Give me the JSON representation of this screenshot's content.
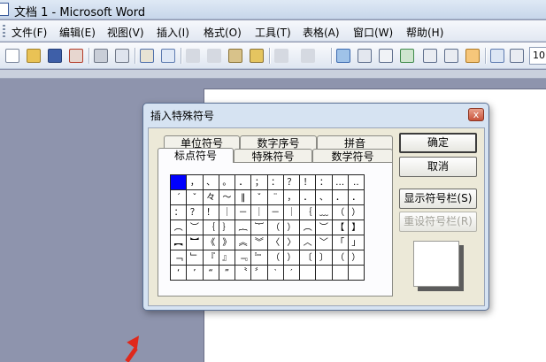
{
  "window": {
    "title": "文档 1 - Microsoft Word"
  },
  "menu": [
    "文件(F)",
    "编辑(E)",
    "视图(V)",
    "插入(I)",
    "格式(O)",
    "工具(T)",
    "表格(A)",
    "窗口(W)",
    "帮助(H)"
  ],
  "toolbar": {
    "zoom_value": "10"
  },
  "dialog": {
    "title": "插入特殊符号",
    "close_label": "x",
    "tabs_back": [
      "单位符号",
      "数字序号",
      "拼音"
    ],
    "tabs_front": [
      "标点符号",
      "特殊符号",
      "数学符号"
    ],
    "active_tab": "标点符号",
    "symbols": [
      [
        "",
        "，",
        "、",
        "。",
        "．",
        "；",
        "：",
        "？",
        "！",
        "：",
        "…",
        "‥"
      ],
      [
        "´",
        "ˇ",
        "々",
        "～",
        "‖",
        "ˇ",
        "¨",
        "，",
        "．",
        "、",
        "．",
        "．"
      ],
      [
        "：",
        "？",
        "！",
        "｜",
        "－",
        "｜",
        "－",
        "｜",
        "｛",
        "﹏",
        "（",
        "）"
      ],
      [
        "︵",
        "︶",
        "｛",
        "｝",
        "︷",
        "︸",
        "（",
        "）",
        "︵",
        "︶",
        "【",
        "】"
      ],
      [
        "︻",
        "︼",
        "《",
        "》",
        "︽",
        "︾",
        "〈",
        "〉",
        "︿",
        "﹀",
        "「",
        "」"
      ],
      [
        "﹁",
        "﹂",
        "『",
        "』",
        "﹃",
        "﹄",
        "（",
        "）",
        "〔",
        "〕",
        "（",
        "）"
      ],
      [
        "‘",
        "’",
        "“",
        "”",
        "〝",
        "〞",
        "‵",
        "′",
        "",
        "",
        "",
        ""
      ]
    ],
    "buttons": {
      "ok": "确定",
      "cancel": "取消",
      "show_bar": "显示符号栏(S)",
      "reset_bar": "重设符号栏(R)"
    }
  }
}
